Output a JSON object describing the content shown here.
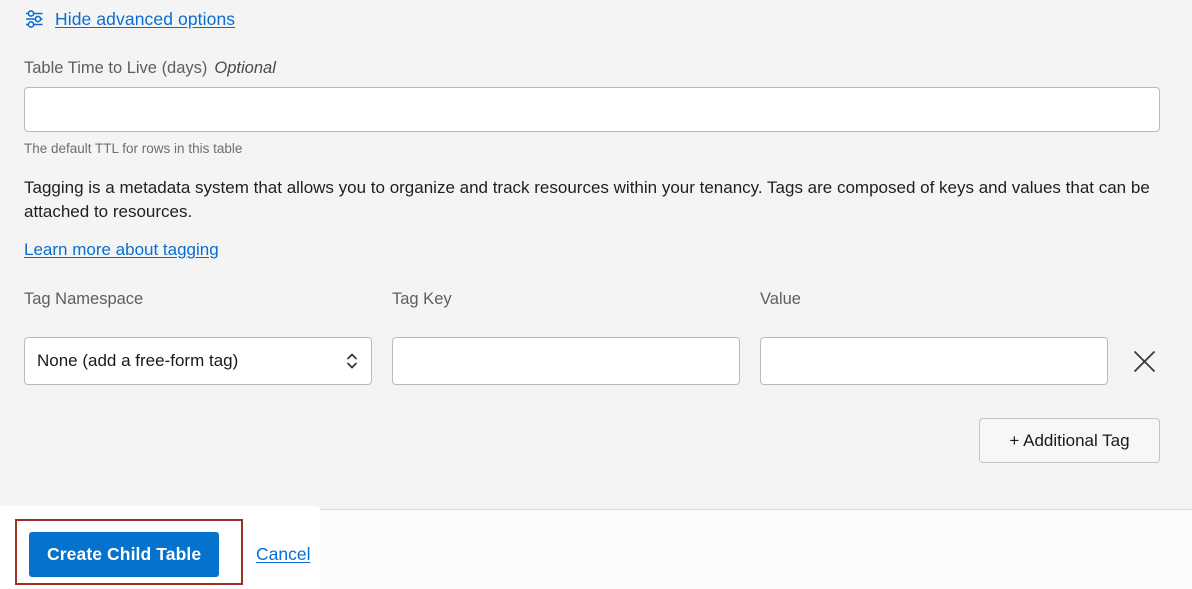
{
  "advanced_options": {
    "icon": "sliders-icon",
    "label": "Hide advanced options"
  },
  "ttl_field": {
    "label": "Table Time to Live (days)",
    "optional_tag": "Optional",
    "value": "",
    "placeholder": "",
    "help_text": "The default TTL for rows in this table"
  },
  "tagging": {
    "description": "Tagging is a metadata system that allows you to organize and track resources within your tenancy. Tags are composed of keys and values that can be attached to resources.",
    "learn_more_label": "Learn more about tagging",
    "columns": {
      "namespace": "Tag Namespace",
      "key": "Tag Key",
      "value": "Value"
    },
    "rows": [
      {
        "namespace_selected": "None (add a free-form tag)",
        "key_value": "",
        "key_placeholder": "",
        "value_value": "",
        "value_placeholder": "",
        "remove_icon": "close-icon"
      }
    ],
    "add_tag_label": "+ Additional Tag"
  },
  "actions": {
    "primary_label": "Create Child Table",
    "cancel_label": "Cancel"
  },
  "colors": {
    "link": "#0a6ed1",
    "primary_button": "#0572ce",
    "annotation": "#9c3224",
    "page_background": "#f4f4f4",
    "bottom_bar_background": "#fbfbfb",
    "input_border": "#b3bac2"
  }
}
